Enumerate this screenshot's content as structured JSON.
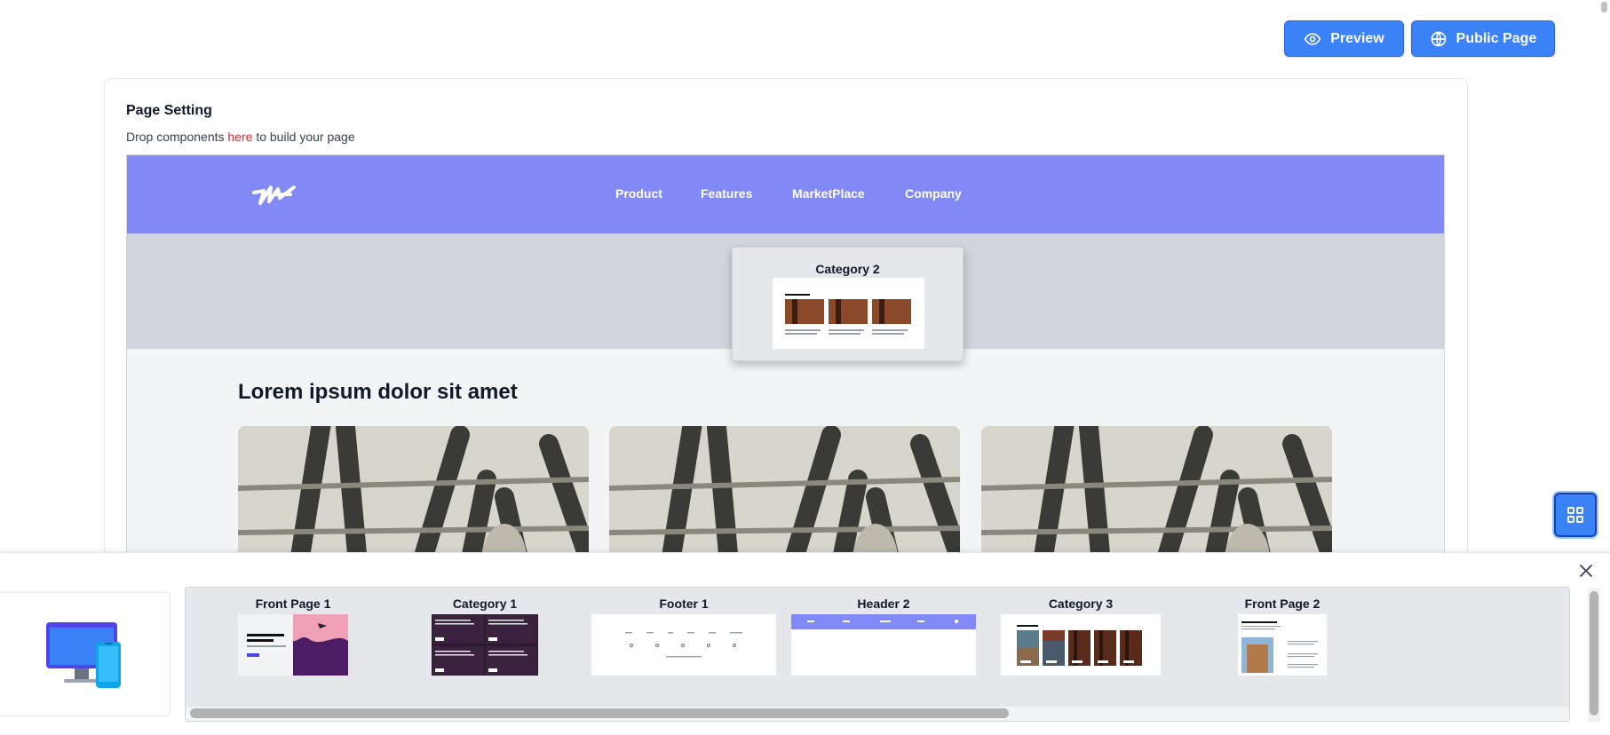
{
  "toolbar": {
    "preview_label": "Preview",
    "public_label": "Public Page"
  },
  "page_setting": {
    "title": "Page Setting",
    "hint_prefix": "Drop components ",
    "hint_link": "here",
    "hint_suffix": " to build your page"
  },
  "canvas": {
    "nav_links": [
      "Product",
      "Features",
      "MarketPlace",
      "Company"
    ],
    "section_title": "Lorem ipsum dolor sit amet"
  },
  "drag_ghost": {
    "title": "Category 2"
  },
  "drawer": {
    "components": [
      {
        "label": "Front Page 1"
      },
      {
        "label": "Category 1"
      },
      {
        "label": "Footer 1"
      },
      {
        "label": "Header 2"
      },
      {
        "label": "Category 3"
      },
      {
        "label": "Front Page 2"
      }
    ]
  },
  "colors": {
    "accent": "#3b82f6",
    "nav_bg": "#8189f7",
    "highlight": "#dc2626"
  }
}
